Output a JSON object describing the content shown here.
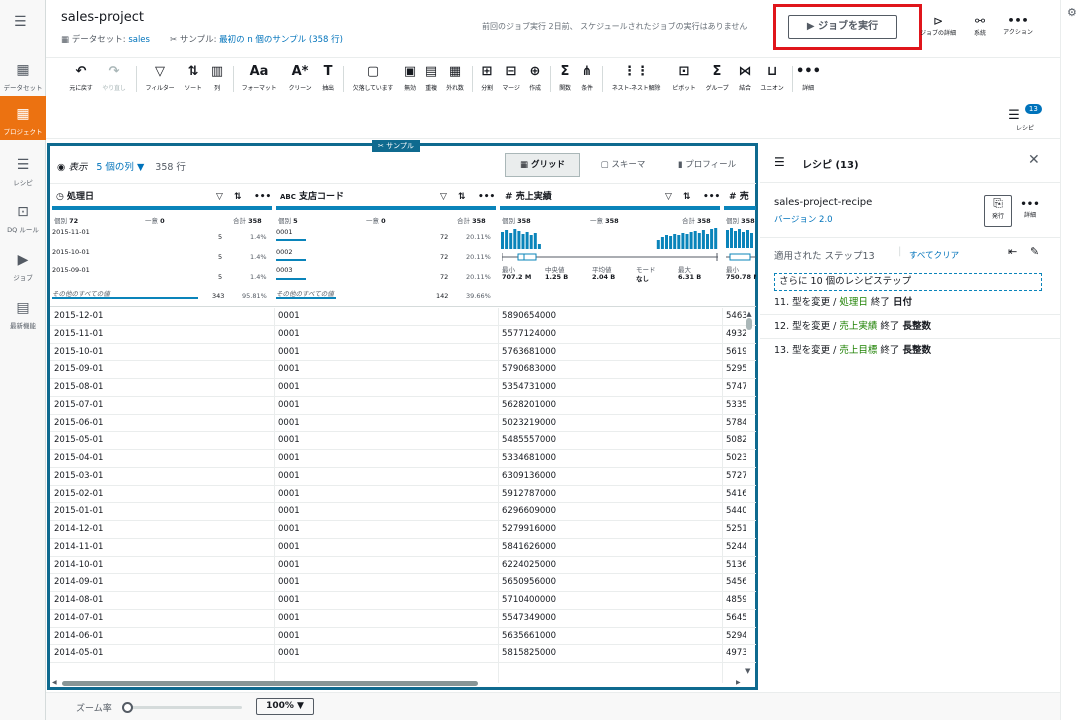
{
  "nav": {
    "items": [
      {
        "label": "データセット",
        "icon": "table-icon"
      },
      {
        "label": "プロジェクト",
        "icon": "grid-icon"
      },
      {
        "label": "レシピ",
        "icon": "list-icon"
      },
      {
        "label": "DQ ルール",
        "icon": "dq-icon"
      },
      {
        "label": "ジョブ",
        "icon": "play-icon"
      },
      {
        "label": "最新機能",
        "icon": "news-icon"
      }
    ]
  },
  "header": {
    "title": "sales-project",
    "dataset_prefix": "データセット:",
    "dataset_name": "sales",
    "sample_prefix": "サンプル:",
    "sample_value": "最初の n 個のサンプル (358 行)",
    "job_status": "前回のジョブ実行 2日前、 スケジュールされたジョブの実行はありません",
    "run_job": "ジョブを実行",
    "actions": [
      {
        "label": "ジョブの詳細"
      },
      {
        "label": "系統"
      },
      {
        "label": "アクション"
      }
    ]
  },
  "toolbar": {
    "items": [
      {
        "label": "元に戻す",
        "icon": "↶"
      },
      {
        "label": "やり直し",
        "icon": "↷"
      },
      {
        "label": "フィルター",
        "icon": "▽"
      },
      {
        "label": "ソート",
        "icon": "⇅"
      },
      {
        "label": "列",
        "icon": "▥"
      },
      {
        "label": "フォーマット",
        "icon": "Aa"
      },
      {
        "label": "クリーン",
        "icon": "A*"
      },
      {
        "label": "抽出",
        "icon": "T"
      },
      {
        "label": "欠落しています",
        "icon": "▢"
      },
      {
        "label": "無効",
        "icon": "▣"
      },
      {
        "label": "重複",
        "icon": "▤"
      },
      {
        "label": "外れ数",
        "icon": "▦"
      },
      {
        "label": "分割",
        "icon": "⊞"
      },
      {
        "label": "マージ",
        "icon": "⊟"
      },
      {
        "label": "作成",
        "icon": "⊕"
      },
      {
        "label": "関数",
        "icon": "Σ"
      },
      {
        "label": "条件",
        "icon": "⋔"
      },
      {
        "label": "ネスト-ネスト解除",
        "icon": "⋮⋮"
      },
      {
        "label": "ピボット",
        "icon": "⊡"
      },
      {
        "label": "グループ",
        "icon": "Σ"
      },
      {
        "label": "結合",
        "icon": "⋈"
      },
      {
        "label": "ユニオン",
        "icon": "⊔"
      },
      {
        "label": "詳細",
        "icon": "•••"
      }
    ],
    "recipe_badge": "13",
    "recipe_label": "レシピ"
  },
  "grid": {
    "sample_tag": "サンプル",
    "view_label": "表示",
    "columns_label": "5 個の列 ▼",
    "rows_label": "358 行",
    "tabs": [
      "グリッド",
      "スキーマ",
      "プロフィール"
    ],
    "columns": [
      {
        "type_icon": "◷",
        "name": "処理日",
        "distinct_label": "個別",
        "distinct": "72",
        "unique_label": "一意",
        "unique": "0",
        "total_label": "合計",
        "total": "358",
        "top": [
          {
            "value": "2015-11-01",
            "count": "5",
            "pct": "1.4%"
          },
          {
            "value": "2015-10-01",
            "count": "5",
            "pct": "1.4%"
          },
          {
            "value": "2015-09-01",
            "count": "5",
            "pct": "1.4%"
          }
        ],
        "other_label": "その他のすべての値",
        "other_count": "343",
        "other_pct": "95.81%"
      },
      {
        "type_icon": "ABC",
        "name": "支店コード",
        "distinct_label": "個別",
        "distinct": "5",
        "unique_label": "一意",
        "unique": "0",
        "total_label": "合計",
        "total": "358",
        "top": [
          {
            "value": "0001",
            "count": "72",
            "pct": "20.11%"
          },
          {
            "value": "0002",
            "count": "72",
            "pct": "20.11%"
          },
          {
            "value": "0003",
            "count": "72",
            "pct": "20.11%"
          }
        ],
        "other_label": "その他のすべての値",
        "other_count": "142",
        "other_pct": "39.66%"
      },
      {
        "type_icon": "#",
        "name": "売上実績",
        "distinct_label": "個別",
        "distinct": "358",
        "unique_label": "一意",
        "unique": "358",
        "total_label": "合計",
        "total": "358",
        "stats": [
          {
            "label": "最小",
            "value": "707.2 M"
          },
          {
            "label": "中央値",
            "value": "1.25 B"
          },
          {
            "label": "平均値",
            "value": "2.04 B"
          },
          {
            "label": "モード",
            "value": "なし"
          },
          {
            "label": "最大",
            "value": "6.31 B"
          }
        ]
      },
      {
        "type_icon": "#",
        "name": "売",
        "distinct_label": "個別",
        "distinct": "358",
        "stats": [
          {
            "label": "最小",
            "value": "750.78 M"
          }
        ]
      }
    ],
    "rows": [
      [
        "2015-12-01",
        "0001",
        "5890654000",
        "5463"
      ],
      [
        "2015-11-01",
        "0001",
        "5577124000",
        "4932"
      ],
      [
        "2015-10-01",
        "0001",
        "5763681000",
        "5619"
      ],
      [
        "2015-09-01",
        "0001",
        "5790683000",
        "5295"
      ],
      [
        "2015-08-01",
        "0001",
        "5354731000",
        "5747"
      ],
      [
        "2015-07-01",
        "0001",
        "5628201000",
        "5335"
      ],
      [
        "2015-06-01",
        "0001",
        "5023219000",
        "5784"
      ],
      [
        "2015-05-01",
        "0001",
        "5485557000",
        "5082"
      ],
      [
        "2015-04-01",
        "0001",
        "5334681000",
        "5023"
      ],
      [
        "2015-03-01",
        "0001",
        "6309136000",
        "5727"
      ],
      [
        "2015-02-01",
        "0001",
        "5912787000",
        "5416"
      ],
      [
        "2015-01-01",
        "0001",
        "6296609000",
        "5440"
      ],
      [
        "2014-12-01",
        "0001",
        "5279916000",
        "5251"
      ],
      [
        "2014-11-01",
        "0001",
        "5841626000",
        "5244"
      ],
      [
        "2014-10-01",
        "0001",
        "6224025000",
        "5136"
      ],
      [
        "2014-09-01",
        "0001",
        "5650956000",
        "5456"
      ],
      [
        "2014-08-01",
        "0001",
        "5710400000",
        "4859"
      ],
      [
        "2014-07-01",
        "0001",
        "5547349000",
        "5645"
      ],
      [
        "2014-06-01",
        "0001",
        "5635661000",
        "5294"
      ],
      [
        "2014-05-01",
        "0001",
        "5815825000",
        "4973"
      ]
    ]
  },
  "recipe": {
    "title": "レシピ (13)",
    "name": "sales-project-recipe",
    "version": "バージョン 2.0",
    "publish": "発行",
    "more": "詳細",
    "applied": "適用された ステップ13",
    "clear_all": "すべてクリア",
    "more_steps": "さらに 10 個のレシピステップ",
    "steps": [
      {
        "prefix": "11. 型を変更 / ",
        "col": "処理日",
        "mid": " 終了 ",
        "type": "日付"
      },
      {
        "prefix": "12. 型を変更 / ",
        "col": "売上実績",
        "mid": " 終了 ",
        "type": "長整数"
      },
      {
        "prefix": "13. 型を変更 / ",
        "col": "売上目標",
        "mid": " 終了 ",
        "type": "長整数"
      }
    ]
  },
  "footer": {
    "zoom_label": "ズーム率",
    "zoom_value": "100%",
    "zoom_fraction": 0.0
  },
  "colors": {
    "accent": "#ec7211",
    "link": "#0073bb",
    "grid_border": "#0f6a8f",
    "highlight": "#e0151b",
    "recipe_col": "#1d8102"
  }
}
